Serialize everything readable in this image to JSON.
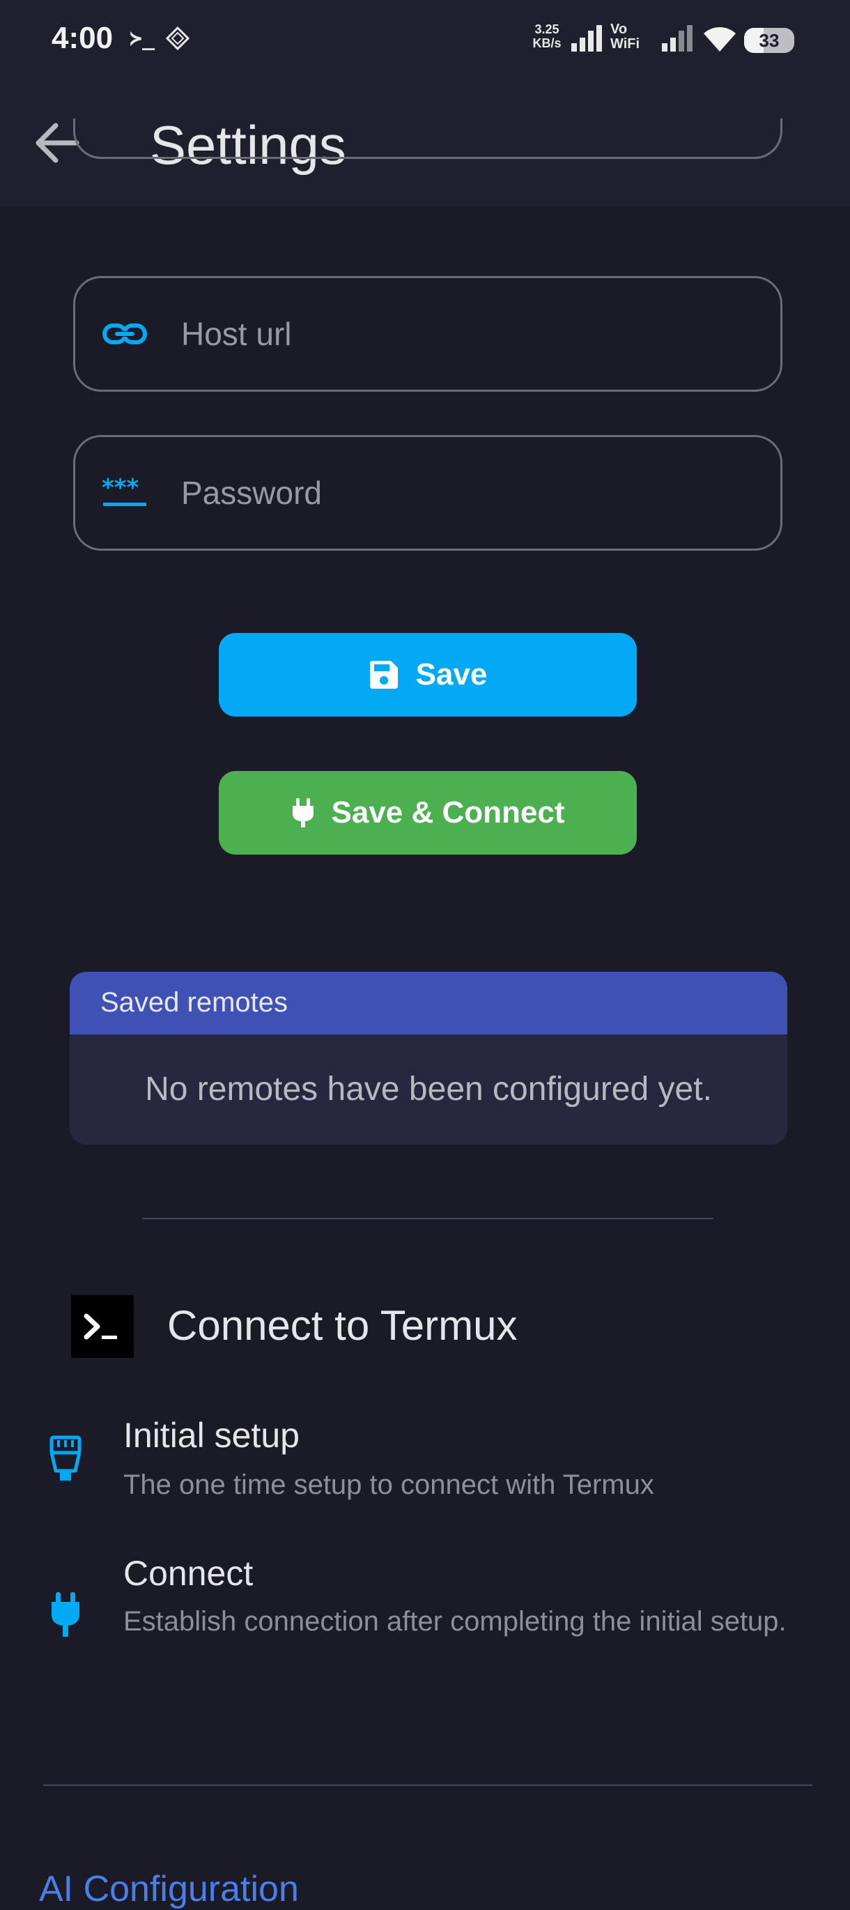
{
  "status_bar": {
    "time": "4:00",
    "terminal_glyph": "≻_",
    "net_speed_value": "3.25",
    "net_speed_unit": "KB/s",
    "vowifi_top": "Vo",
    "vowifi_bottom": "WiFi",
    "battery": "33"
  },
  "app_bar": {
    "title": "Settings",
    "back_icon": "arrow-left-icon"
  },
  "form": {
    "host_url": {
      "value": "",
      "placeholder": "Host url",
      "icon": "link-icon"
    },
    "password": {
      "value": "",
      "placeholder": "Password",
      "icon": "password-icon"
    },
    "save_label": "Save",
    "save_connect_label": "Save & Connect"
  },
  "saved_remotes": {
    "header": "Saved remotes",
    "empty_text": "No remotes have been configured yet."
  },
  "termux": {
    "title": "Connect to Termux",
    "items": [
      {
        "title": "Initial setup",
        "subtitle": "The one time setup to connect with Termux",
        "icon": "ethernet-plug-icon"
      },
      {
        "title": "Connect",
        "subtitle": "Establish connection after completing the initial setup.",
        "icon": "power-plug-icon"
      }
    ]
  },
  "next_section_title": "AI Configuration",
  "colors": {
    "background": "#1a1b26",
    "bar": "#1f1f2e",
    "accent_blue": "#03a9f4",
    "accent_green": "#4caf50",
    "card_header": "#3f51b5",
    "link_blue": "#4a7ee8"
  }
}
